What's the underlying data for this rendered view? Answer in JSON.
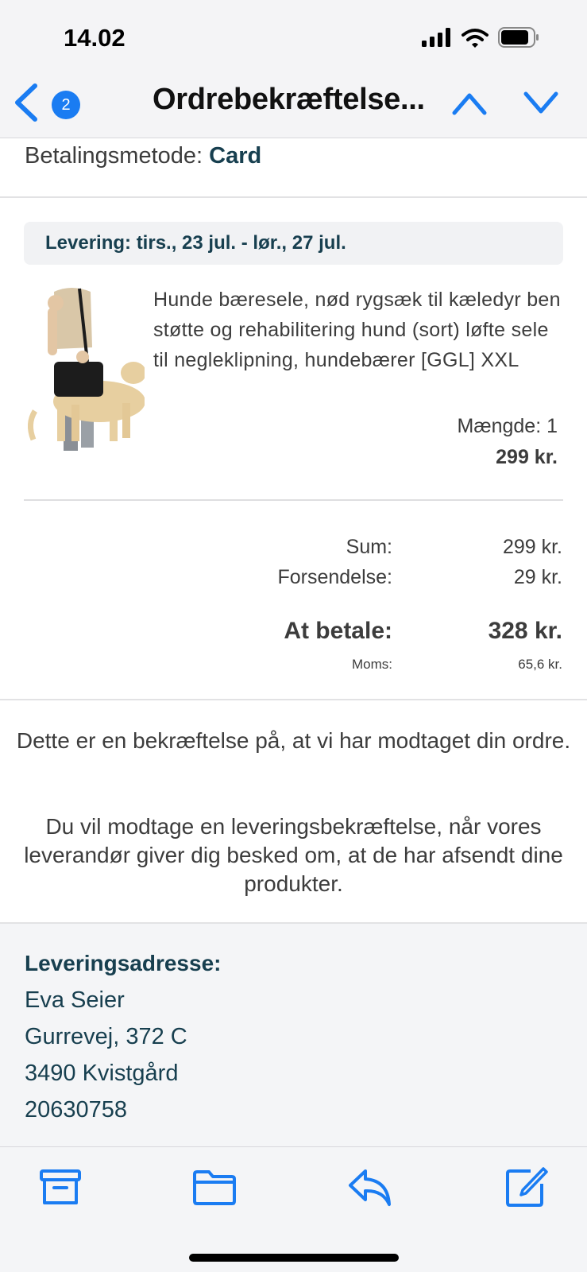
{
  "status_bar": {
    "time": "14.02",
    "icons": [
      "cellular-signal-icon",
      "wifi-icon",
      "battery-icon"
    ]
  },
  "nav": {
    "back_icon": "chevron-left-icon",
    "unread_count": "2",
    "title": "Ordrebekræftelse...",
    "prev_icon": "chevron-up-icon",
    "next_icon": "chevron-down-icon"
  },
  "order": {
    "payment_label": "Betalingsmetode:",
    "payment_value": "Card",
    "delivery": "Levering: tirs., 23 jul. - lør., 27 jul.",
    "product": {
      "description": "Hunde bæresele, nød rygsæk til kæledyr ben støtte og rehabilitering hund (sort) løfte sele til negleklipning, hundebærer [GGL] XXL",
      "quantity": "Mængde: 1",
      "price": "299 kr."
    },
    "totals": {
      "sum_label": "Sum:",
      "sum_value": "299 kr.",
      "shipping_label": "Forsendelse:",
      "shipping_value": "29 kr.",
      "total_label": "At betale:",
      "total_value": "328 kr.",
      "vat_label": "Moms:",
      "vat_value": "65,6 kr."
    },
    "confirmation_1": "Dette er en bekræftelse på, at vi har modtaget din ordre.",
    "confirmation_2": "Du vil modtage en leveringsbekræftelse, når vores leverandør giver dig besked om, at de har afsendt dine produkter."
  },
  "address": {
    "heading": "Leveringsadresse:",
    "name": "Eva Seier",
    "street": "Gurrevej, 372 C",
    "city": "3490 Kvistgård",
    "phone": "20630758"
  },
  "toolbar": {
    "items": [
      "archive-icon",
      "folder-icon",
      "reply-icon",
      "compose-icon"
    ]
  },
  "colors": {
    "accent": "#1a7cf2",
    "heading": "#173f4f",
    "text": "#3c3c3c"
  }
}
